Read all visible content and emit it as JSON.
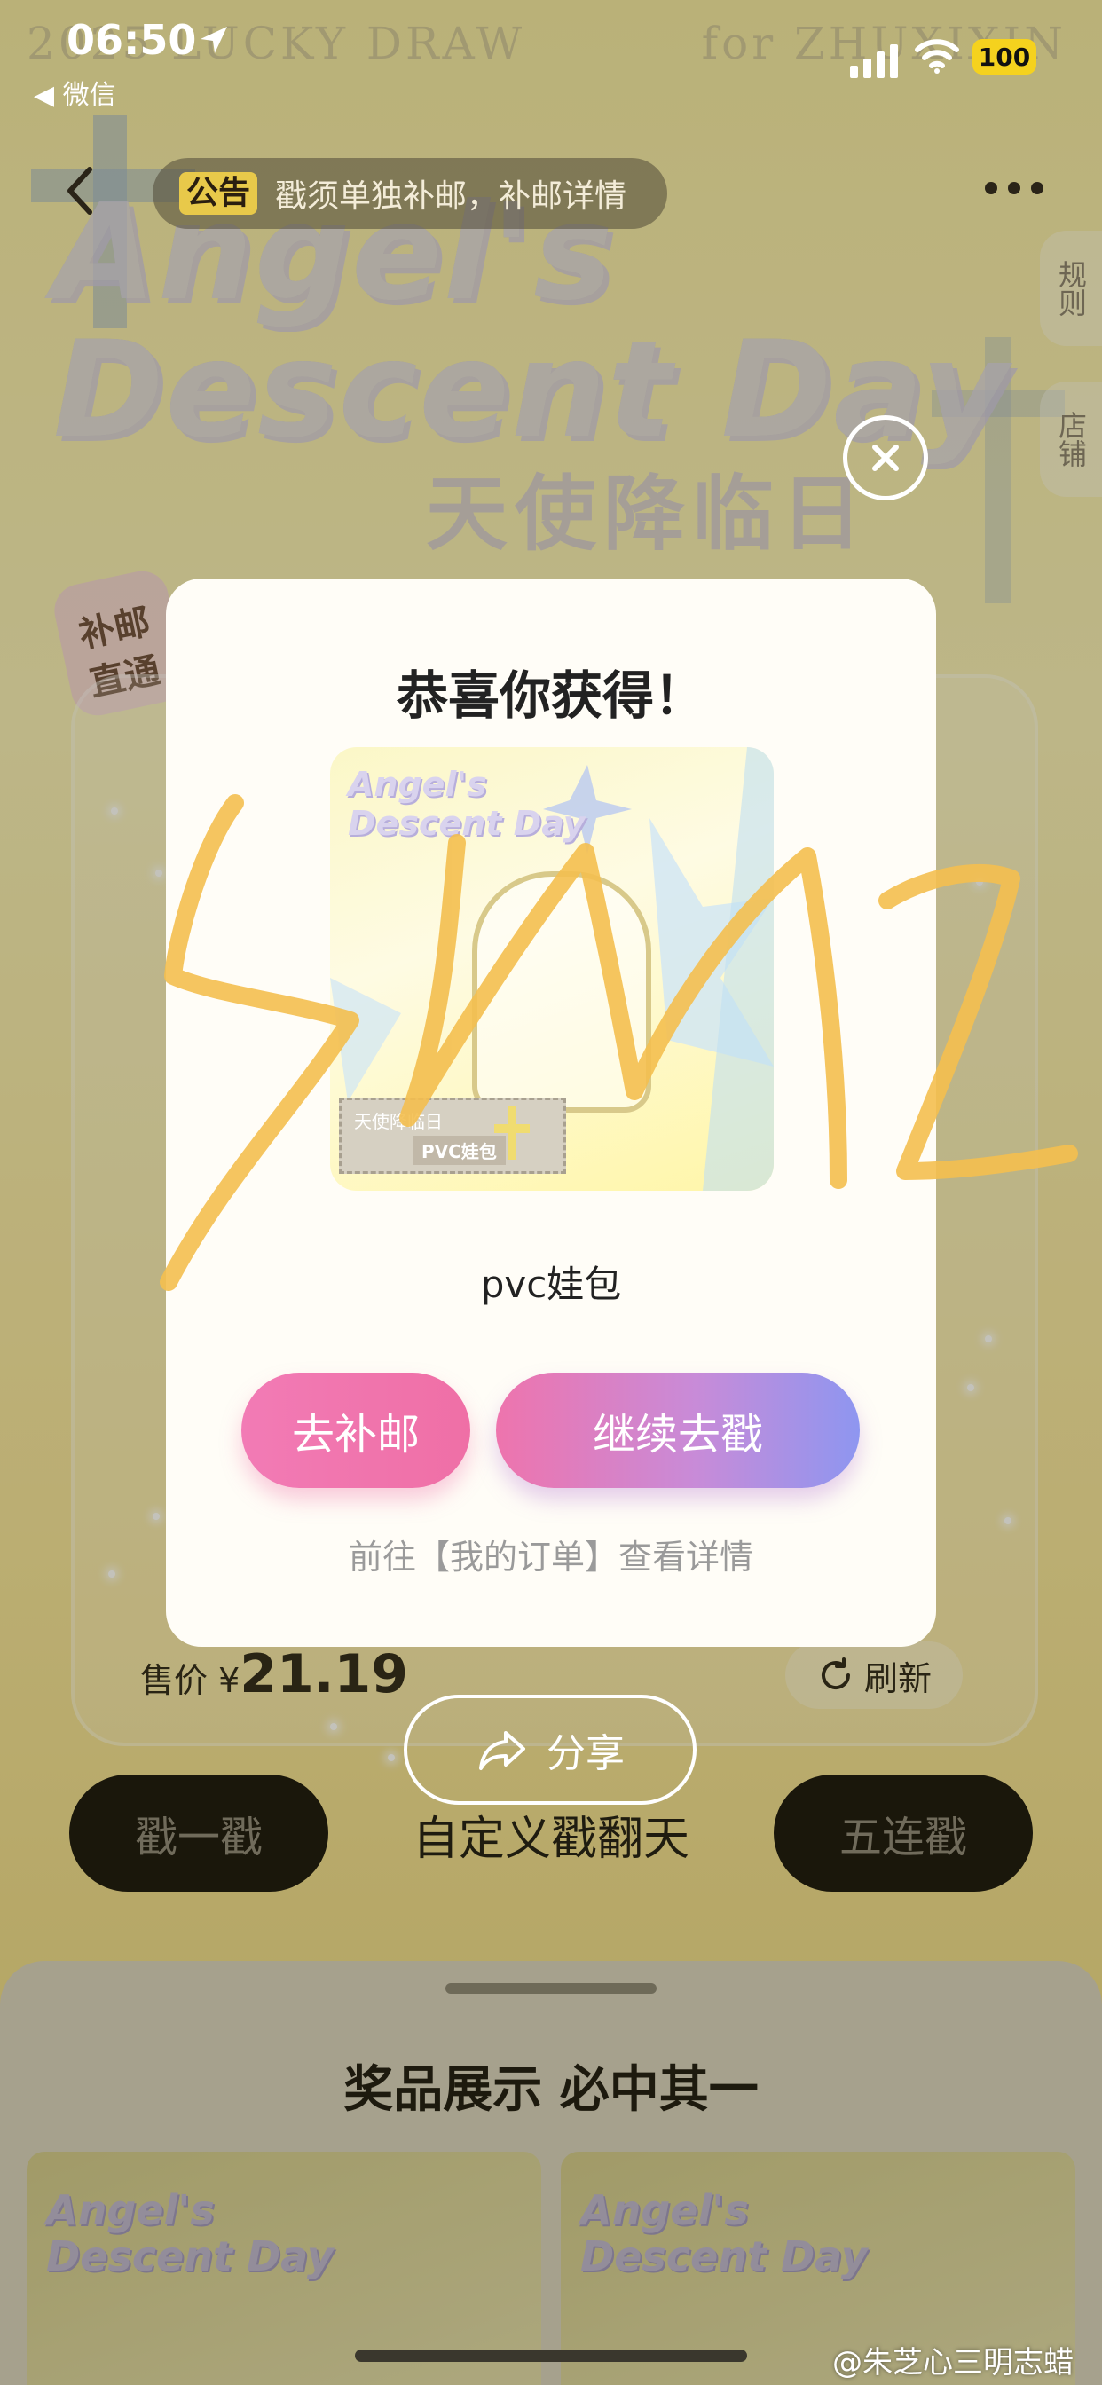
{
  "status_bar": {
    "time": "06:50",
    "back_app": "◀ 微信",
    "battery": "100"
  },
  "background": {
    "script_left": "2025 LUCKY DRAW",
    "script_right": "for ZHUXIXIN",
    "title_line1": "Angel's",
    "title_line2": "Descent Day",
    "subtitle": "天使降临日",
    "badge_line1": "补邮",
    "badge_line2": "直通",
    "side_tab_rules": "规则",
    "side_tab_shop": "店铺"
  },
  "notice": {
    "tag": "公告",
    "text": "戳须单独补邮，补邮详情"
  },
  "modal": {
    "title": "恭喜你获得！",
    "prize_logo_line1": "Angel's",
    "prize_logo_line2": "Descent Day",
    "prize_label_line1": "天使降临日",
    "prize_label_line2": "PVC娃包",
    "prize_name": "pvc娃包",
    "shipping_button": "去补邮",
    "continue_button": "继续去戳",
    "hint": "前往【我的订单】查看详情"
  },
  "page": {
    "price_label": "售价 ¥",
    "price_value": "21.19",
    "refresh_label": "刷新",
    "share_label": "分享",
    "single_draw": "戳一戳",
    "custom_draw": "自定义戳翻天",
    "five_draw": "五连戳"
  },
  "sheet": {
    "title": "奖品展示 必中其一",
    "card_logo_line1": "Angel's",
    "card_logo_line2": "Descent Day"
  },
  "watermark": "@朱芝心三明志蜡",
  "colors": {
    "pink": "#ef6fa6",
    "purple": "#8e96f0",
    "battery": "#f5d21e",
    "scribble": "#f4bf4f"
  }
}
